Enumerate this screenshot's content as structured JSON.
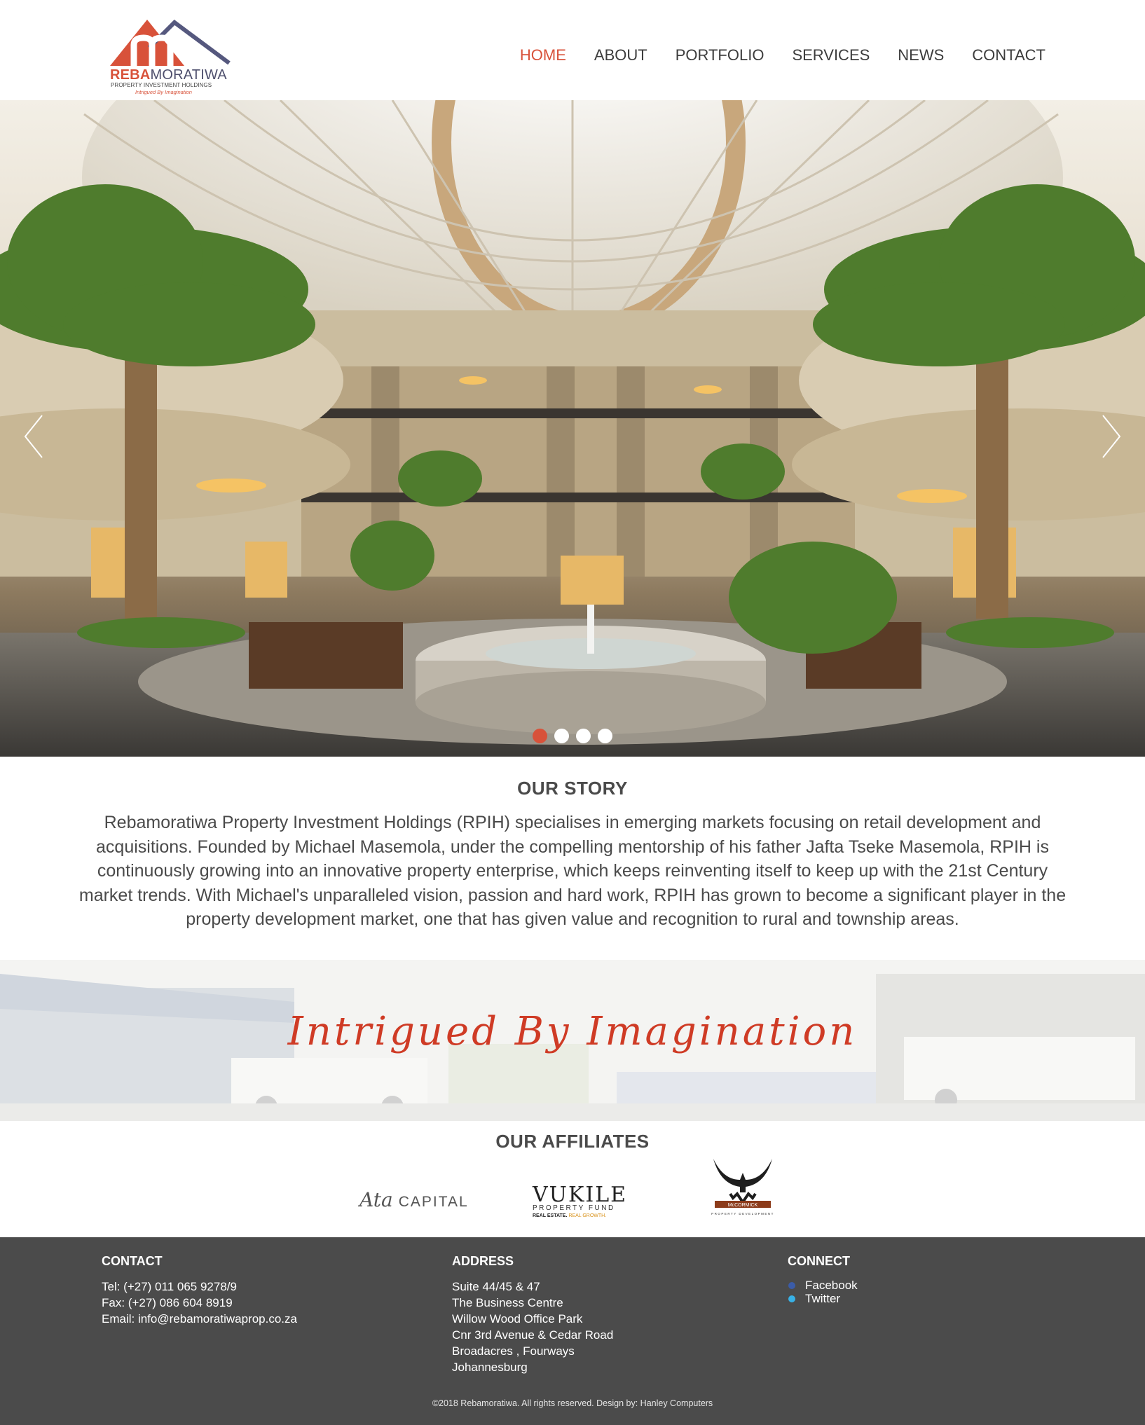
{
  "header": {
    "logo": {
      "brand_a": "REBA",
      "brand_b": "MORATIWA",
      "subtitle": "PROPERTY INVESTMENT HOLDINGS",
      "tagline": "Intrigued By Imagination"
    },
    "nav": [
      {
        "label": "HOME",
        "active": true
      },
      {
        "label": "ABOUT"
      },
      {
        "label": "PORTFOLIO"
      },
      {
        "label": "SERVICES"
      },
      {
        "label": "NEWS"
      },
      {
        "label": "CONTACT"
      }
    ]
  },
  "hero": {
    "slide_count": 4,
    "active_slide": 1,
    "icons": {
      "prev": "chevron-left-icon",
      "next": "chevron-right-icon"
    }
  },
  "story": {
    "heading": "OUR STORY",
    "body": "Rebamoratiwa Property Investment Holdings (RPIH) specialises in emerging markets focusing on retail development and acquisitions. Founded by Michael Masemola, under the compelling mentorship of his father Jafta Tseke Masemola, RPIH is continuously growing into an innovative property enterprise, which keeps reinventing itself to keep up with the 21st Century market trends. With Michael's unparalleled vision, passion and hard work, RPIH has grown to become a significant player in the property development market, one that has given value and recognition to rural and township areas."
  },
  "banner": {
    "text": "Intrigued By Imagination"
  },
  "affiliates": {
    "heading": "OUR AFFILIATES",
    "ata": {
      "mark": "Ata",
      "word": "CAPITAL"
    },
    "vukile": {
      "name": "VUKILE",
      "sub": "PROPERTY FUND",
      "tag_a": "REAL ESTATE.",
      "tag_b": "REAL GROWTH."
    },
    "mccormick": {
      "name": "McCORMICK",
      "sub": "PROPERTY DEVELOPMENT"
    }
  },
  "footer": {
    "contact": {
      "heading": "CONTACT",
      "tel": "Tel: (+27) 011 065 9278/9",
      "fax": "Fax: (+27) 086 604 8919",
      "email": "Email: info@rebamoratiwaprop.co.za"
    },
    "address": {
      "heading": "ADDRESS",
      "lines": [
        "Suite 44/45 & 47",
        "The Business Centre",
        "Willow Wood Office Park",
        "Cnr 3rd Avenue & Cedar Road",
        "Broadacres , Fourways",
        "Johannesburg"
      ]
    },
    "connect": {
      "heading": "CONNECT",
      "facebook": "Facebook",
      "twitter": "Twitter"
    },
    "copyright": "©2018 Rebamoratiwa. All rights reserved. Design by: Hanley Computers"
  },
  "colors": {
    "accent": "#d8523a",
    "footer_bg": "#4b4b4b",
    "text": "#4a4a4a"
  }
}
